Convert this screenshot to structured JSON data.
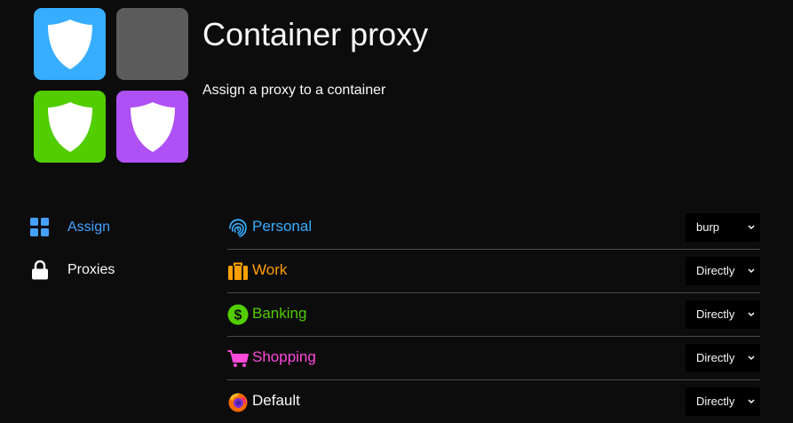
{
  "app": {
    "title": "Container proxy",
    "subtitle": "Assign a proxy to a container"
  },
  "logo": {
    "tiles": [
      {
        "color": "#37adff",
        "icon": "shield-icon"
      },
      {
        "color": "#5b5b5b",
        "icon": ""
      },
      {
        "color": "#51cd00",
        "icon": "shield-icon"
      },
      {
        "color": "#af51f5",
        "icon": "shield-icon"
      }
    ]
  },
  "sidebar": {
    "items": [
      {
        "label": "Assign",
        "icon": "grid-icon",
        "active": true
      },
      {
        "label": "Proxies",
        "icon": "lock-icon",
        "active": false
      }
    ]
  },
  "containers": [
    {
      "name": "Personal",
      "icon": "fingerprint-icon",
      "color": "#37adff",
      "proxy": "burp"
    },
    {
      "name": "Work",
      "icon": "briefcase-icon",
      "color": "#ff9f00",
      "proxy": "Directly"
    },
    {
      "name": "Banking",
      "icon": "dollar-icon",
      "color": "#51cd00",
      "proxy": "Directly"
    },
    {
      "name": "Shopping",
      "icon": "cart-icon",
      "color": "#ff4bda",
      "proxy": "Directly"
    },
    {
      "name": "Default",
      "icon": "firefox-icon",
      "color": "#f9f9fa",
      "proxy": "Directly"
    }
  ],
  "colors": {
    "background": "#0c0c0d",
    "accent": "#45a1ff",
    "select_background": "#000000"
  }
}
